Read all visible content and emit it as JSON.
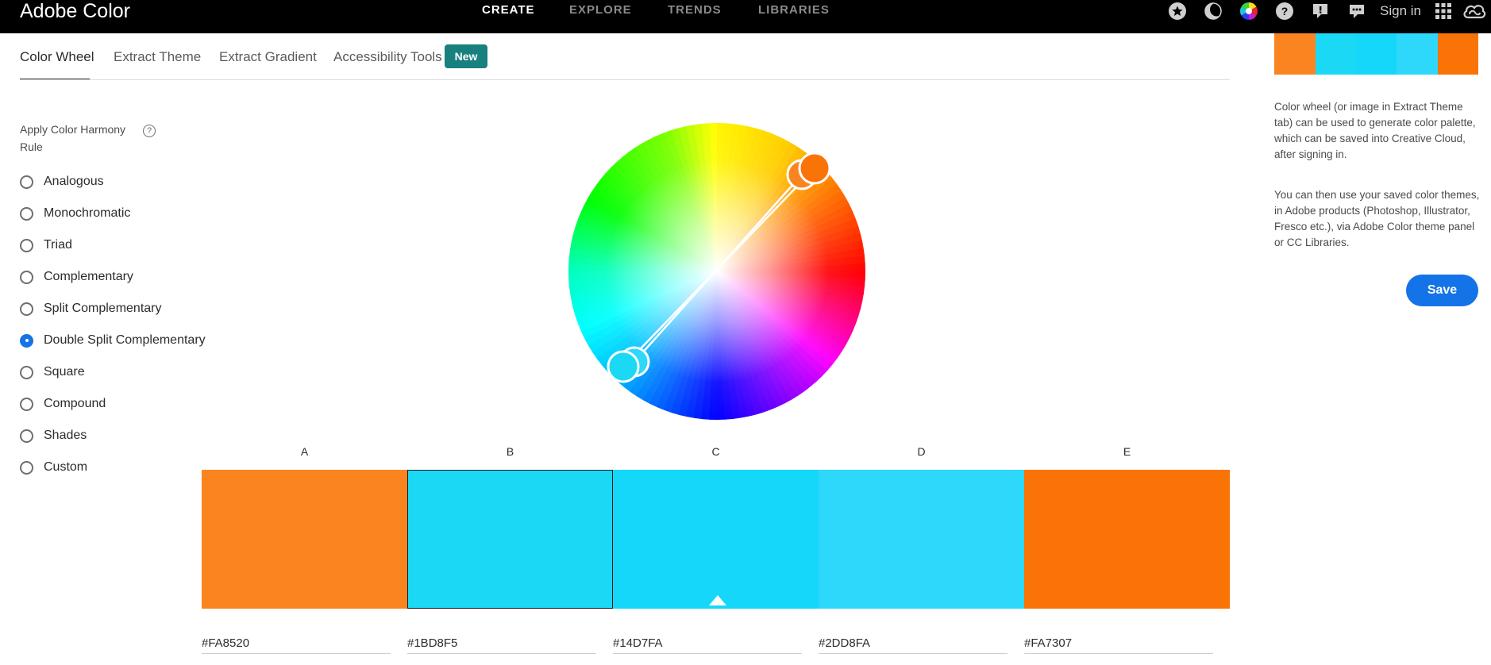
{
  "app": {
    "title": "Adobe Color"
  },
  "nav": [
    "CREATE",
    "EXPLORE",
    "TRENDS",
    "LIBRARIES"
  ],
  "header": {
    "signin": "Sign in",
    "icons": [
      "star-icon",
      "moon-icon",
      "color-wheel-icon",
      "help-icon",
      "feedback-icon",
      "chat-icon",
      "apps-grid-icon",
      "creative-cloud-icon"
    ]
  },
  "tabs": [
    "Color Wheel",
    "Extract Theme",
    "Extract Gradient",
    "Accessibility Tools"
  ],
  "active_tab": "Color Wheel",
  "new_badge": "New",
  "harmony": {
    "title": "Apply Color Harmony Rule",
    "help": "?",
    "selected": "Double Split Complementary",
    "rules": [
      "Analogous",
      "Monochromatic",
      "Triad",
      "Complementary",
      "Split Complementary",
      "Double Split Complementary",
      "Square",
      "Compound",
      "Shades",
      "Custom"
    ]
  },
  "swatches": [
    {
      "label": "A",
      "color": "#FA8520",
      "hex": "#FA8520"
    },
    {
      "label": "B",
      "color": "#1BD8F5",
      "hex": "#1BD8F5"
    },
    {
      "label": "C",
      "color": "#14D7FA",
      "hex": "#14D7FA"
    },
    {
      "label": "D",
      "color": "#2DD8FA",
      "hex": "#2DD8FA"
    },
    {
      "label": "E",
      "color": "#FA7307",
      "hex": "#FA7307"
    }
  ],
  "selected_swatch": "B",
  "base_swatch": "C",
  "info": {
    "p1": "Color wheel (or image in Extract Theme tab) can be used to generate color palette, which can be saved into Creative Cloud, after signing in.",
    "p2": "You can then use your saved color themes, in Adobe products (Photoshop, Illustrator, Fresco etc.), via Adobe Color theme panel or CC Libraries."
  },
  "save_label": "Save",
  "colors": {
    "accent": "#1473e6",
    "new_badge": "#198080",
    "topbar": "#000000"
  }
}
